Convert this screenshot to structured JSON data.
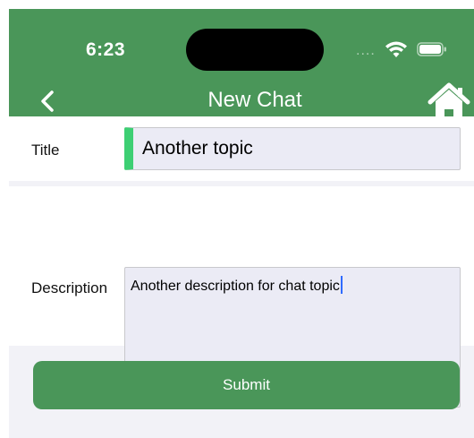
{
  "status_bar": {
    "time": "6:23",
    "signal_dots": "....",
    "wifi_icon": "wifi-icon",
    "battery_icon": "battery-icon"
  },
  "nav": {
    "title": "New Chat",
    "back_icon": "chevron-left-icon",
    "home_icon": "home-icon"
  },
  "form": {
    "title_label": "Title",
    "title_value": "Another topic",
    "description_label": "Description",
    "description_value": "Another description for chat topic",
    "submit_label": "Submit"
  },
  "colors": {
    "accent": "#4a9659",
    "focus_bar": "#3dcf73",
    "field_bg": "#ebebf5",
    "caret": "#2f6bff"
  }
}
